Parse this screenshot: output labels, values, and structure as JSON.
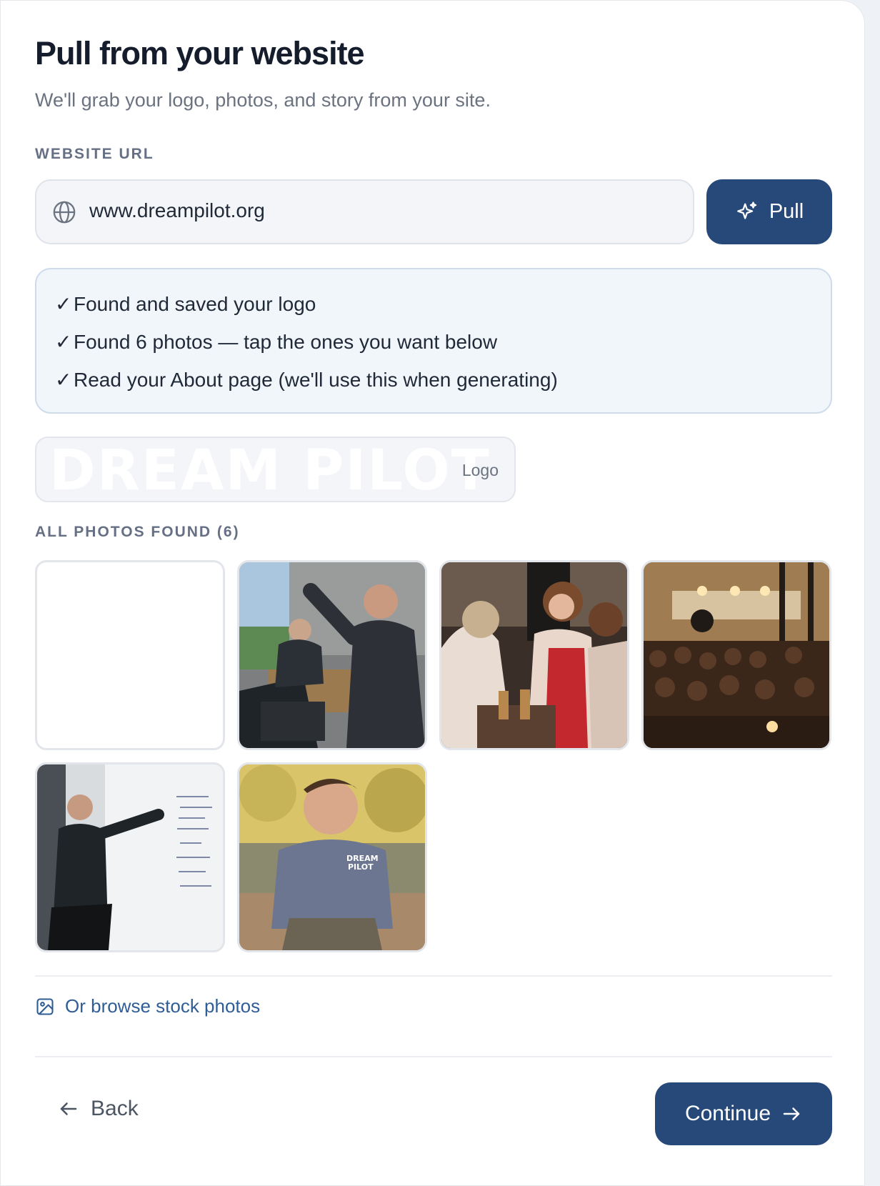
{
  "header": {
    "title": "Pull from your website",
    "subtitle": "We'll grab your logo, photos, and story from your site."
  },
  "url_section": {
    "label": "WEBSITE URL",
    "value": "www.dreampilot.org",
    "icon": "globe-icon",
    "pull_label": "Pull",
    "pull_icon": "sparkle-icon"
  },
  "status": {
    "check": "✓",
    "lines": [
      "Found and saved your logo",
      "Found 6 photos — tap the ones you want below",
      "Read your About page (we'll use this when generating)"
    ]
  },
  "logo": {
    "wordmark": "DREAM PILOT",
    "tag": "Logo"
  },
  "photos": {
    "label": "ALL PHOTOS FOUND (6)",
    "items": [
      {
        "kind": "blank"
      },
      {
        "kind": "office-meeting"
      },
      {
        "kind": "women-event"
      },
      {
        "kind": "banquet-hall"
      },
      {
        "kind": "whiteboard-presenter"
      },
      {
        "kind": "portrait"
      }
    ]
  },
  "stock": {
    "label": "Or browse stock photos",
    "icon": "image-icon"
  },
  "footer": {
    "back_label": "Back",
    "continue_label": "Continue"
  },
  "colors": {
    "primary": "#26497a",
    "link": "#2f5d97",
    "status_bg": "#f1f6fb"
  }
}
